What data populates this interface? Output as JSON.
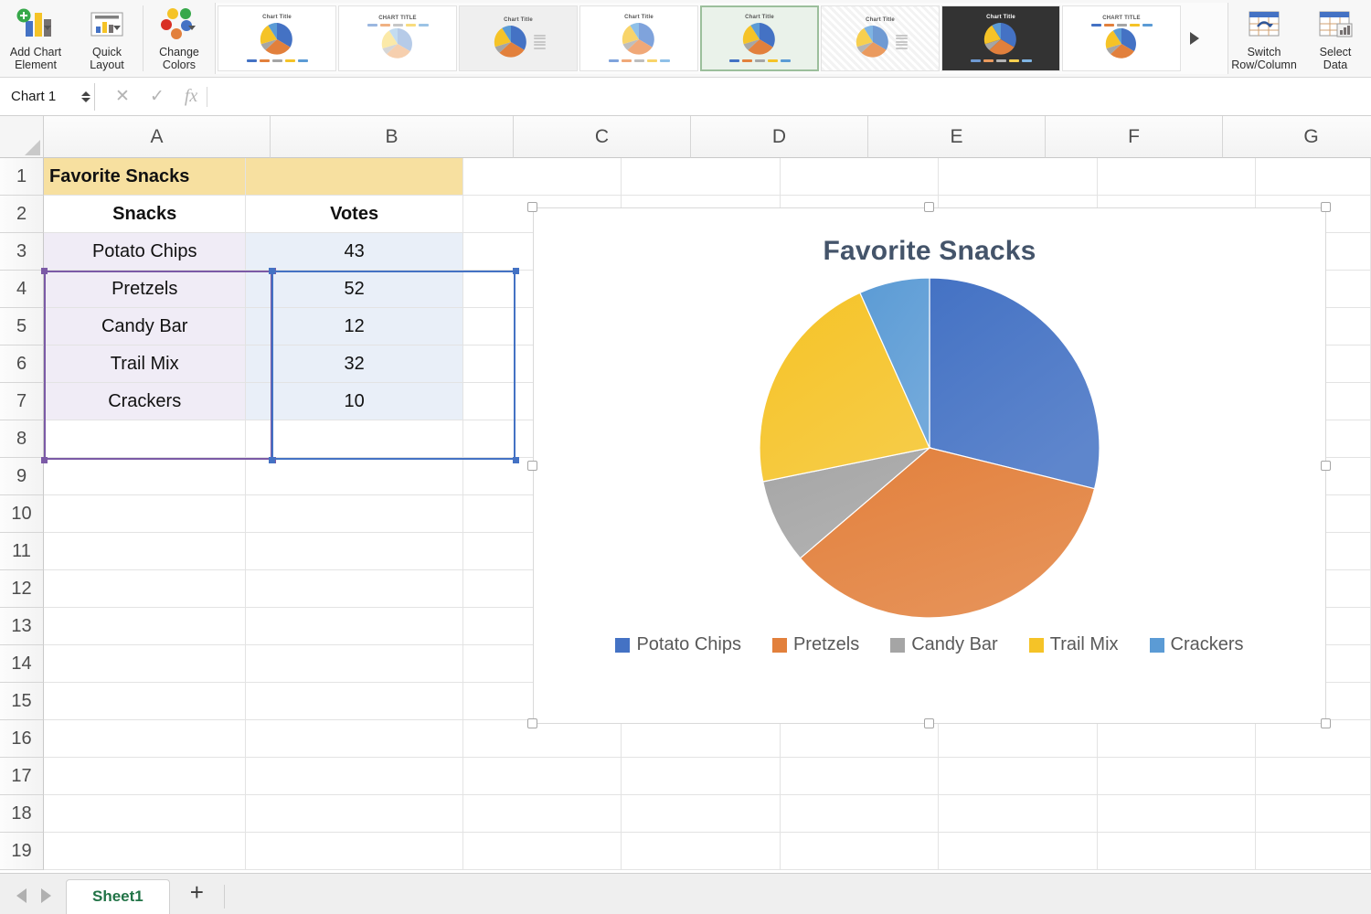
{
  "ribbon": {
    "buttons": [
      {
        "name": "add-chart-element",
        "label_line1": "Add Chart",
        "label_line2": "Element"
      },
      {
        "name": "quick-layout",
        "label_line1": "Quick",
        "label_line2": "Layout"
      },
      {
        "name": "change-colors",
        "label_line1": "Change",
        "label_line2": "Colors"
      }
    ],
    "right_buttons": [
      {
        "name": "switch-row-column",
        "label_line1": "Switch",
        "label_line2": "Row/Column"
      },
      {
        "name": "select-data",
        "label_line1": "Select",
        "label_line2": "Data"
      }
    ],
    "gallery": {
      "thumb_title_normal": "Chart Title",
      "thumb_title_caps": "CHART TITLE",
      "selected_index": 4,
      "styles": [
        {
          "id": "style-1",
          "variant": "plain"
        },
        {
          "id": "style-2",
          "variant": "hatch-caps"
        },
        {
          "id": "style-3",
          "variant": "gray-labels"
        },
        {
          "id": "style-4",
          "variant": "pastel"
        },
        {
          "id": "style-5",
          "variant": "plain"
        },
        {
          "id": "style-6",
          "variant": "hatch-side"
        },
        {
          "id": "style-7",
          "variant": "dark"
        },
        {
          "id": "style-8",
          "variant": "caps-labels"
        }
      ],
      "more_arrow": "scroll-right"
    }
  },
  "formula_bar": {
    "name_box_value": "Chart 1",
    "cancel_icon": "✕",
    "confirm_icon": "✓",
    "function_icon": "fx",
    "formula_value": ""
  },
  "grid": {
    "columns": [
      "A",
      "B",
      "C",
      "D",
      "E",
      "F",
      "G"
    ],
    "rows": [
      "1",
      "2",
      "3",
      "4",
      "5",
      "6",
      "7",
      "8",
      "9",
      "10",
      "11",
      "12",
      "13",
      "14",
      "15",
      "16",
      "17",
      "18",
      "19"
    ],
    "data": {
      "A1": "Favorite Snacks",
      "A2": "Snacks",
      "B2": "Votes",
      "A3": "Potato Chips",
      "B3": "43",
      "A4": "Pretzels",
      "B4": "52",
      "A5": "Candy Bar",
      "B5": "12",
      "A6": "Trail Mix",
      "B6": "32",
      "A7": "Crackers",
      "B7": "10"
    },
    "highlight_color": "#f7e0a0",
    "selection_a_color": "#7b5aa6",
    "selection_b_color": "#4472c4"
  },
  "chart": {
    "object_name": "Chart 1",
    "selected": true
  },
  "chart_data": {
    "type": "pie",
    "title": "Favorite Snacks",
    "categories": [
      "Potato Chips",
      "Pretzels",
      "Candy Bar",
      "Trail Mix",
      "Crackers"
    ],
    "values": [
      43,
      52,
      12,
      32,
      10
    ],
    "total": 149,
    "colors": [
      "#4472c4",
      "#e2803c",
      "#a5a5a5",
      "#f5c327",
      "#5b9bd5"
    ],
    "legend_position": "bottom",
    "title_color": "#44546a",
    "start_angle_deg": 0,
    "xlabel": "",
    "ylabel": ""
  },
  "sheet_tabs": {
    "prev_icon": "◀",
    "next_icon": "▶",
    "tabs": [
      "Sheet1"
    ],
    "active_tab": "Sheet1",
    "add_label": "+"
  }
}
